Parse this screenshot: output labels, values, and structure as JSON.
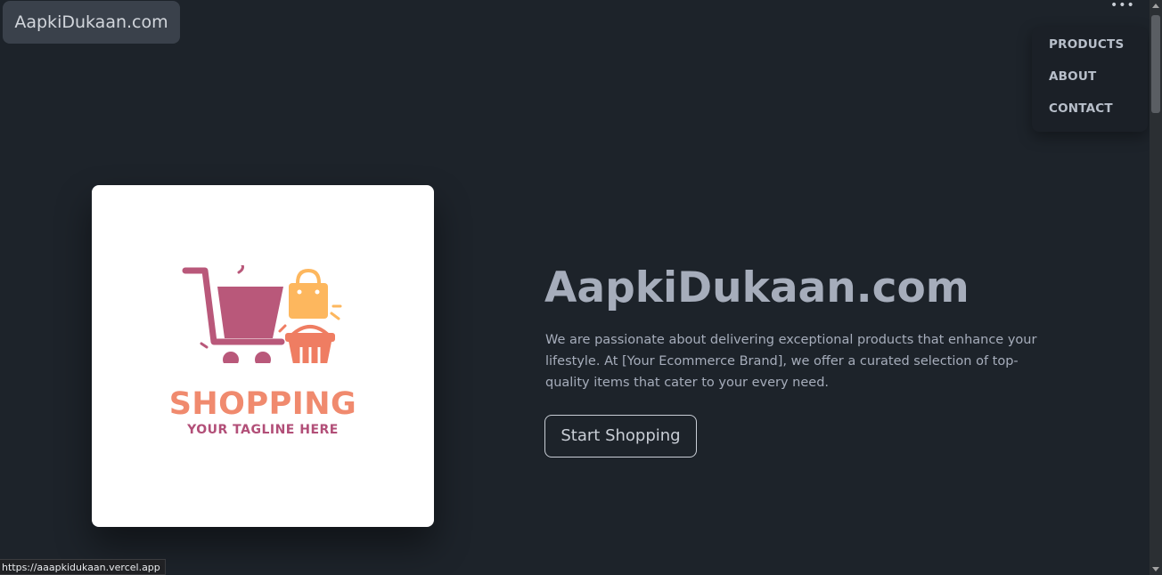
{
  "header": {
    "brand_label": "AapkiDukaan.com",
    "menu_icon": "ellipsis-icon"
  },
  "dropdown": {
    "items": [
      {
        "label": "PRODUCTS"
      },
      {
        "label": "ABOUT"
      },
      {
        "label": "CONTACT"
      }
    ]
  },
  "hero": {
    "image": {
      "logo_title": "SHOPPING",
      "logo_tagline": "YOUR TAGLINE HERE",
      "colors": {
        "cart": "#b9587a",
        "bag": "#fdb75e",
        "basket": "#ef7d62",
        "title": "#f08a6e",
        "tagline": "#b24f78"
      }
    },
    "title": "AapkiDukaan.com",
    "description": "We are passionate about delivering exceptional products that enhance your lifestyle. At [Your Ecommerce Brand], we offer a curated selection of top-quality items that cater to your every need.",
    "cta_label": "Start Shopping"
  },
  "status_bar": {
    "url": "https://aaapkidukaan.vercel.app"
  },
  "theme": {
    "background": "#1d232a",
    "text": "#a6adbb"
  }
}
